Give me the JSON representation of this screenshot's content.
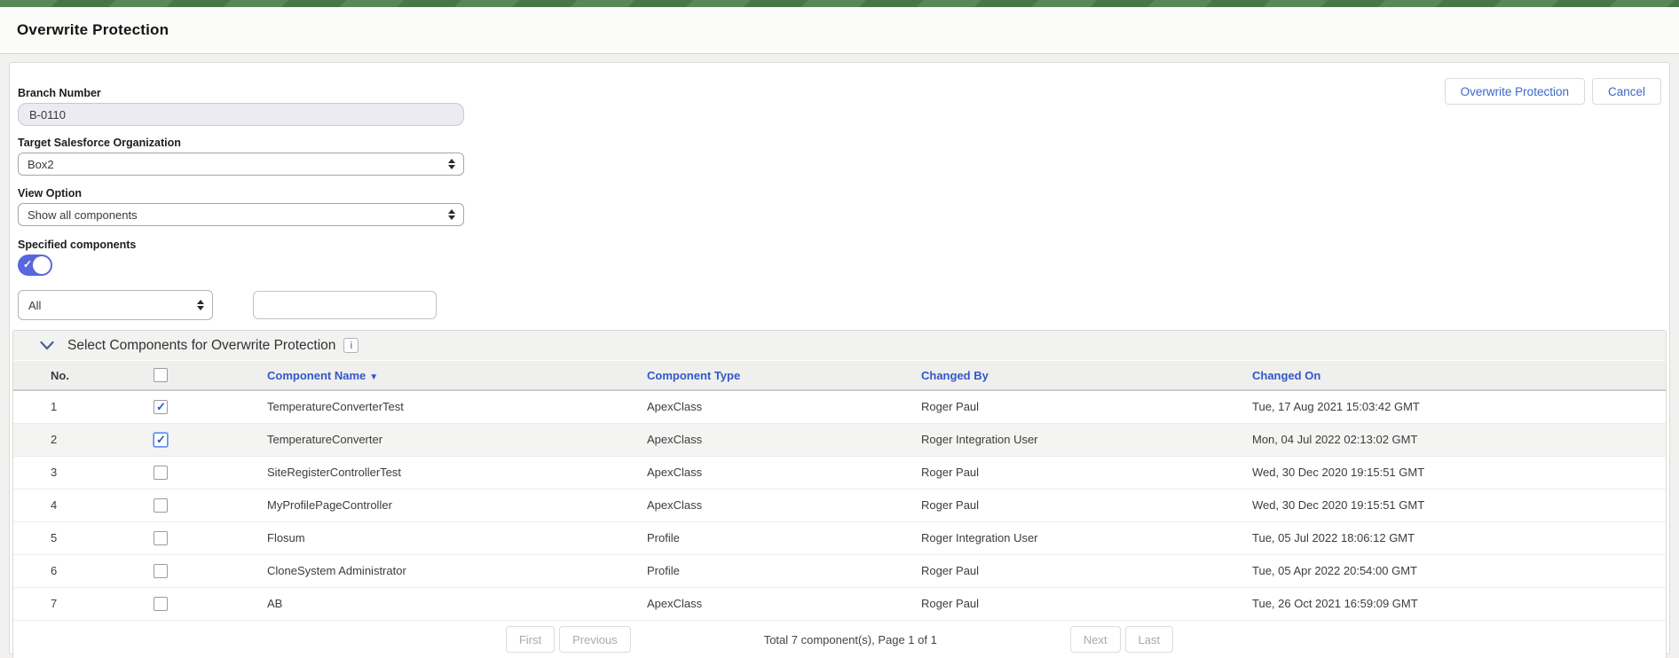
{
  "page": {
    "title": "Overwrite Protection"
  },
  "actions": {
    "primary_label": "Overwrite Protection",
    "cancel_label": "Cancel"
  },
  "form": {
    "branch_number": {
      "label": "Branch Number",
      "value": "B-0110"
    },
    "target_org": {
      "label": "Target Salesforce Organization",
      "value": "Box2"
    },
    "view_option": {
      "label": "View Option",
      "value": "Show all components"
    },
    "specified_components": {
      "label": "Specified components",
      "enabled": true
    },
    "filter_type": {
      "value": "All"
    },
    "filter_text": {
      "value": ""
    }
  },
  "table": {
    "section_title": "Select Components for Overwrite Protection",
    "info_icon": "i",
    "columns": {
      "no": "No.",
      "name": "Component Name",
      "type": "Component Type",
      "changed_by": "Changed By",
      "changed_on": "Changed On"
    },
    "sort_indicator": "▼",
    "rows": [
      {
        "no": "1",
        "checked": true,
        "focused": false,
        "name": "TemperatureConverterTest",
        "type": "ApexClass",
        "changed_by": "Roger Paul",
        "changed_on": "Tue, 17 Aug 2021 15:03:42 GMT"
      },
      {
        "no": "2",
        "checked": true,
        "focused": true,
        "name": "TemperatureConverter",
        "type": "ApexClass",
        "changed_by": "Roger Integration User",
        "changed_on": "Mon, 04 Jul 2022 02:13:02 GMT"
      },
      {
        "no": "3",
        "checked": false,
        "focused": false,
        "name": "SiteRegisterControllerTest",
        "type": "ApexClass",
        "changed_by": "Roger Paul",
        "changed_on": "Wed, 30 Dec 2020 19:15:51 GMT"
      },
      {
        "no": "4",
        "checked": false,
        "focused": false,
        "name": "MyProfilePageController",
        "type": "ApexClass",
        "changed_by": "Roger Paul",
        "changed_on": "Wed, 30 Dec 2020 19:15:51 GMT"
      },
      {
        "no": "5",
        "checked": false,
        "focused": false,
        "name": "Flosum",
        "type": "Profile",
        "changed_by": "Roger Integration User",
        "changed_on": "Tue, 05 Jul 2022 18:06:12 GMT"
      },
      {
        "no": "6",
        "checked": false,
        "focused": false,
        "name": "CloneSystem Administrator",
        "type": "Profile",
        "changed_by": "Roger Paul",
        "changed_on": "Tue, 05 Apr 2022 20:54:00 GMT"
      },
      {
        "no": "7",
        "checked": false,
        "focused": false,
        "name": "AB",
        "type": "ApexClass",
        "changed_by": "Roger Paul",
        "changed_on": "Tue, 26 Oct 2021 16:59:09 GMT"
      }
    ],
    "pagination": {
      "first": "First",
      "previous": "Previous",
      "summary": "Total 7 component(s), Page 1 of 1",
      "next": "Next",
      "last": "Last"
    }
  },
  "colors": {
    "brand_green": "#4f7d4a",
    "link_blue": "#3b67c6",
    "header_blue": "#3257c9",
    "toggle_blue": "#5867dd"
  }
}
